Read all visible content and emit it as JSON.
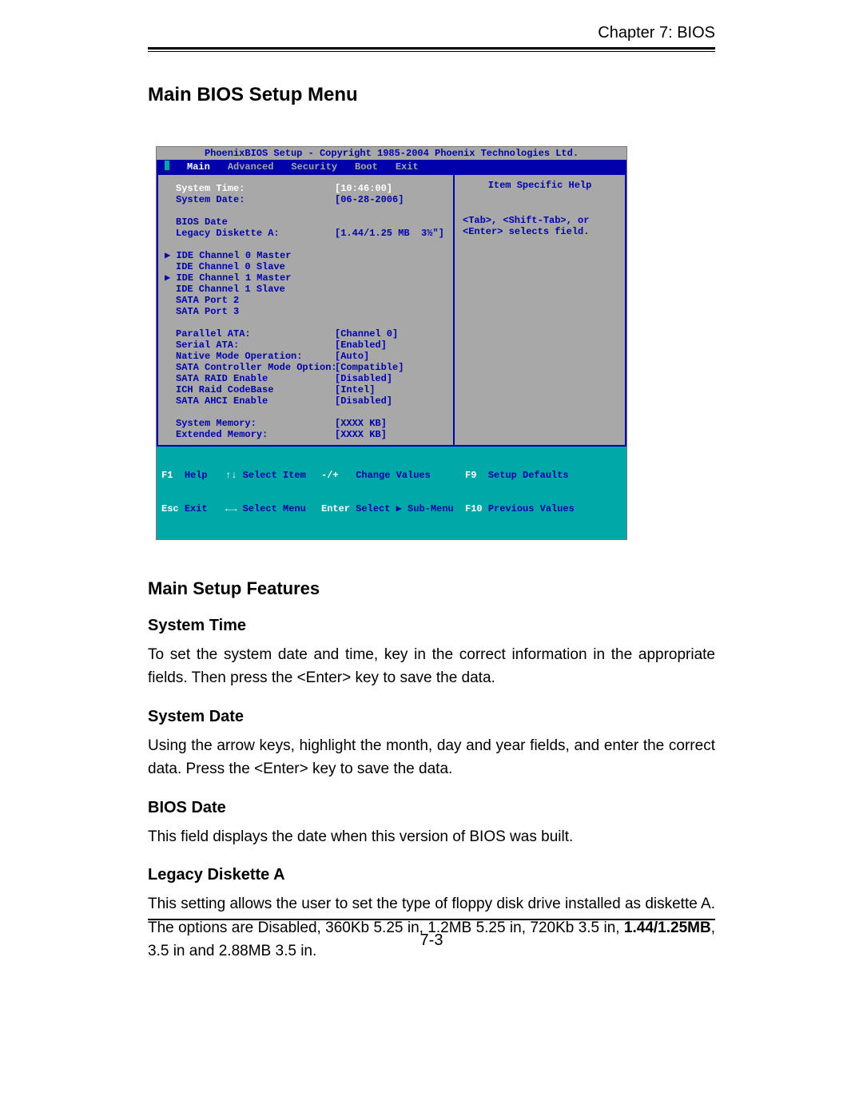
{
  "chapter": "Chapter 7: BIOS",
  "h1": "Main BIOS Setup Menu",
  "bios": {
    "title": "PhoenixBIOS Setup - Copyright 1985-2004 Phoenix Technologies Ltd.",
    "tabs": {
      "main": "Main",
      "advanced": "Advanced",
      "security": "Security",
      "boot": "Boot",
      "exit": "Exit"
    },
    "left": {
      "system_time_label": "System Time:",
      "system_time_val": "[10:46:00]",
      "system_date_label": "System Date:",
      "system_date_val": "[06-28-2006]",
      "bios_date_label": "BIOS Date",
      "legacy_a_label": "Legacy Diskette A:",
      "legacy_a_val": "[1.44/1.25 MB  3½\"]",
      "ide0m": "IDE Channel 0 Master",
      "ide0s": "IDE Channel 0 Slave",
      "ide1m": "IDE Channel 1 Master",
      "ide1s": "IDE Channel 1 Slave",
      "sata2": "SATA Port 2",
      "sata3": "SATA Port 3",
      "pata_label": "Parallel ATA:",
      "pata_val": "[Channel 0]",
      "sata_label": "Serial ATA:",
      "sata_val": "[Enabled]",
      "native_label": "Native Mode Operation:",
      "native_val": "[Auto]",
      "sctrl_label": "SATA Controller Mode Option:",
      "sctrl_val": "[Compatible]",
      "raid_label": "SATA RAID Enable",
      "raid_val": "[Disabled]",
      "ich_label": "ICH Raid CodeBase",
      "ich_val": "[Intel]",
      "ahci_label": "SATA AHCI Enable",
      "ahci_val": "[Disabled]",
      "sysmem_label": "System Memory:",
      "sysmem_val": "[XXXX KB]",
      "extmem_label": "Extended Memory:",
      "extmem_val": "[XXXX KB]"
    },
    "help": {
      "title": "Item Specific Help",
      "line1": "<Tab>, <Shift-Tab>, or",
      "line2": "<Enter> selects field."
    },
    "footer": {
      "f1": "F1",
      "help": "Help",
      "ud": "↑↓",
      "select_item": "Select Item",
      "pm": "-/+",
      "change_values": "Change Values",
      "f9": "F9",
      "setup_defaults": "Setup Defaults",
      "esc": "Esc",
      "exit": "Exit",
      "lr": "←→",
      "select_menu": "Select Menu",
      "enter": "Enter",
      "select_sub": "Select ▶ Sub-Menu",
      "f10": "F10",
      "prev_values": "Previous Values"
    }
  },
  "h2": "Main Setup Features",
  "sections": {
    "system_time": {
      "title": "System Time",
      "body": "To set the system date and time, key in the correct information in the appropriate fields.  Then press the <Enter> key to save the data."
    },
    "system_date": {
      "title": "System Date",
      "body": "Using the arrow keys, highlight the month, day and year fields, and enter the correct data.  Press the <Enter> key to save the data."
    },
    "bios_date": {
      "title": "BIOS Date",
      "body": "This field displays the date when this version of BIOS was built."
    },
    "legacy_a": {
      "title": "Legacy Diskette A",
      "body_pre": "This setting allows the user to set the type of floppy disk drive installed as diskette A. The options are Disabled, 360Kb 5.25 in, 1.2MB 5.25 in, 720Kb 3.5 in, ",
      "body_bold": "1.44/1.25MB",
      "body_post": ", 3.5 in and 2.88MB 3.5 in."
    }
  },
  "page_number": "7-3"
}
